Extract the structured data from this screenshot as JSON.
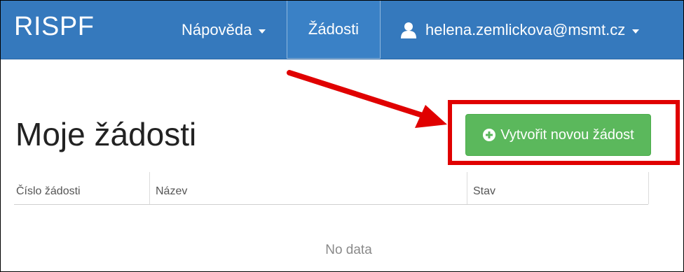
{
  "navbar": {
    "brand": "RISPF",
    "help_label": "Nápověda",
    "requests_label": "Žádosti",
    "user_email": "helena.zemlickova@msmt.cz"
  },
  "main": {
    "title": "Moje žádosti",
    "create_button_label": "Vytvořit novou žádost"
  },
  "table": {
    "columns": [
      "Číslo žádosti",
      "Název",
      "Stav"
    ],
    "empty_text": "No data"
  },
  "colors": {
    "navbar": "#3579bd",
    "button": "#5bb85c",
    "highlight": "#e00000"
  }
}
